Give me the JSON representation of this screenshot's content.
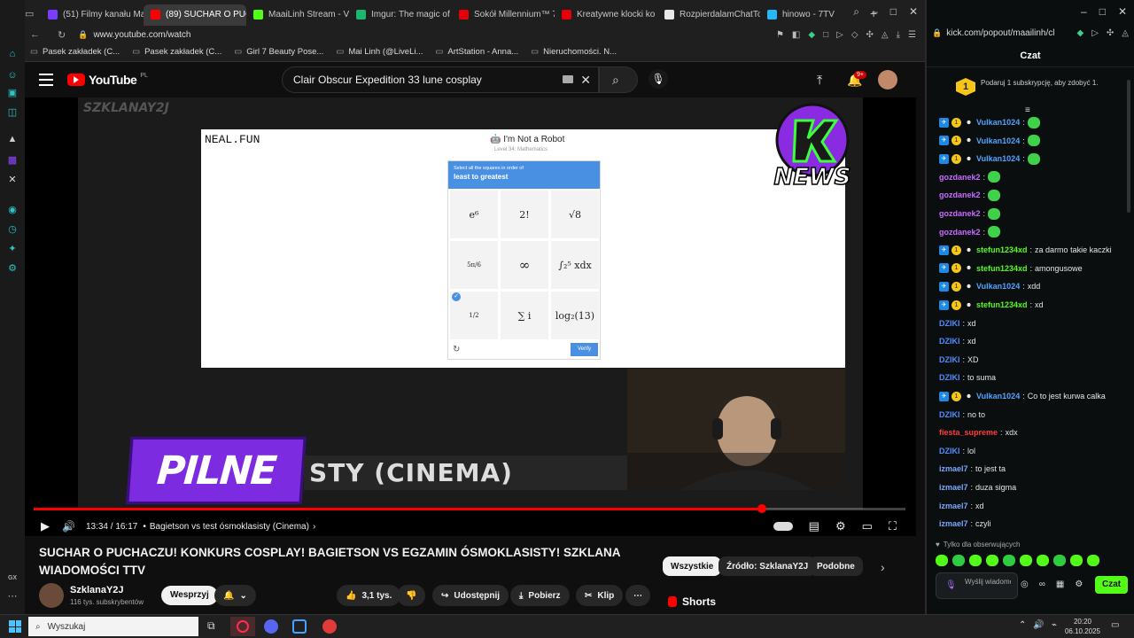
{
  "tabs": [
    {
      "label": "(51) Filmy kanału Ma",
      "color": "#7a3cff"
    },
    {
      "label": "(89) SUCHAR O PUCHAC",
      "color": "#ff0000",
      "active": true
    },
    {
      "label": "MaaiLinh Stream - V",
      "color": "#53fc18"
    },
    {
      "label": "Imgur: The magic of",
      "color": "#1bb76e"
    },
    {
      "label": "Sokół Millennium™ 7",
      "color": "#e3000b"
    },
    {
      "label": "Kreatywne klocki ko",
      "color": "#e3000b"
    },
    {
      "label": "RozpierdalamChatTo",
      "color": "#e8e8e8"
    },
    {
      "label": "hinowo - 7TV",
      "color": "#29b6f6"
    }
  ],
  "address": "www.youtube.com/watch",
  "bookmarks": [
    "Pasek zakładek (C...",
    "Pasek zakładek (C...",
    "Girl 7 Beauty Pose...",
    "Mai Linh (@LiveLi...",
    "ArtStation - Anna...",
    "Nieruchomości. N..."
  ],
  "youtube": {
    "logo": "YouTube",
    "country": "PL",
    "search_query": "Clair Obscur Expedition 33 lune cosplay",
    "notif_count": "9+"
  },
  "video": {
    "watermark": "SZKLANAY2J",
    "site_logo": "NEAL.FUN",
    "captcha_title": "I'm Not a Robot",
    "captcha_level": "Level 34: Mathematics",
    "captcha_instr": "Select all the squares in order of",
    "captcha_order": "least to greatest",
    "cells": [
      "e⁶",
      "2!",
      "√8",
      "5π/6",
      "∞",
      "∫₂⁵ xdx",
      "1/2",
      "∑ i",
      "log₂(13)"
    ],
    "verify_label": "Verify",
    "pilne": "PILNE",
    "ticker": "STY (CINEMA)",
    "news": "NEWS",
    "time": "13:34 / 16:17",
    "chapter": "Bagietson vs test ósmoklasisty (Cinema)",
    "progress": 0.835
  },
  "video_title": "SUCHAR O PUCHACZU! KONKURS COSPLAY! BAGIETSON VS EGZAMIN ÓSMOKLASISTY! SZKLANA WIADOMOŚCI TTV",
  "channel": {
    "name": "SzklanaY2J",
    "subs": "116 tys. subskrybentów",
    "support": "Wesprzyj"
  },
  "actions": {
    "likes": "3,1 tys.",
    "share": "Udostępnij",
    "download": "Pobierz",
    "clip": "Klip"
  },
  "chips": [
    "Wszystkie",
    "Źródło: SzklanaY2J",
    "Podobne"
  ],
  "shorts": "Shorts",
  "kick": {
    "url": "kick.com/popout/maailinh/cl",
    "header": "Czat",
    "gift": "Podaruj 1 subskrypcję, aby zdobyć 1.",
    "followers_only": "Tylko dla obserwujących",
    "input_placeholder": "Wyślij wiadomość",
    "send": "Czat",
    "messages": [
      {
        "user": "Vulkan1024",
        "color": "#4fa3ff",
        "text": "",
        "badges": true,
        "emote": true
      },
      {
        "user": "Vulkan1024",
        "color": "#4fa3ff",
        "text": "",
        "badges": true,
        "emote": true
      },
      {
        "user": "Vulkan1024",
        "color": "#4fa3ff",
        "text": "",
        "badges": true,
        "emote": true
      },
      {
        "user": "gozdanek2",
        "color": "#c86bff",
        "text": "",
        "badges": false,
        "emote": true
      },
      {
        "user": "gozdanek2",
        "color": "#c86bff",
        "text": "",
        "badges": false,
        "emote": true
      },
      {
        "user": "gozdanek2",
        "color": "#c86bff",
        "text": "",
        "badges": false,
        "emote": true
      },
      {
        "user": "gozdanek2",
        "color": "#c86bff",
        "text": "",
        "badges": false,
        "emote": true
      },
      {
        "user": "stefun1234xd",
        "color": "#53fc18",
        "text": "za darmo takie kaczki",
        "badges": true,
        "emote": false
      },
      {
        "user": "stefun1234xd",
        "color": "#53fc18",
        "text": "amongusowe",
        "badges": true,
        "emote": false
      },
      {
        "user": "Vulkan1024",
        "color": "#4fa3ff",
        "text": "xdd",
        "badges": true,
        "emote": false
      },
      {
        "user": "stefun1234xd",
        "color": "#53fc18",
        "text": "xd",
        "badges": true,
        "emote": false
      },
      {
        "user": "DZIKI",
        "color": "#4f8dff",
        "text": "xd",
        "badges": false,
        "emote": false
      },
      {
        "user": "DZIKI",
        "color": "#4f8dff",
        "text": "xd",
        "badges": false,
        "emote": false
      },
      {
        "user": "DZIKI",
        "color": "#4f8dff",
        "text": "XD",
        "badges": false,
        "emote": false
      },
      {
        "user": "DZIKI",
        "color": "#4f8dff",
        "text": "to suma",
        "badges": false,
        "emote": false
      },
      {
        "user": "Vulkan1024",
        "color": "#4fa3ff",
        "text": "Co to jest kurwa calka",
        "badges": true,
        "emote": false
      },
      {
        "user": "DZIKI",
        "color": "#4f8dff",
        "text": "no to",
        "badges": false,
        "emote": false
      },
      {
        "user": "fiesta_supreme",
        "color": "#ff3b3b",
        "text": "xdx",
        "badges": false,
        "emote": false
      },
      {
        "user": "DZIKI",
        "color": "#4f8dff",
        "text": "lol",
        "badges": false,
        "emote": false
      },
      {
        "user": "izmael7",
        "color": "#7aa7ff",
        "text": "to jest ta",
        "badges": false,
        "emote": false
      },
      {
        "user": "izmael7",
        "color": "#7aa7ff",
        "text": "duza sigma",
        "badges": false,
        "emote": false
      },
      {
        "user": "izmael7",
        "color": "#7aa7ff",
        "text": "xd",
        "badges": false,
        "emote": false
      },
      {
        "user": "izmael7",
        "color": "#7aa7ff",
        "text": "czyli",
        "badges": false,
        "emote": false
      }
    ]
  },
  "taskbar": {
    "search": "Wyszukaj",
    "time": "20:20",
    "date": "06.10.2025"
  }
}
